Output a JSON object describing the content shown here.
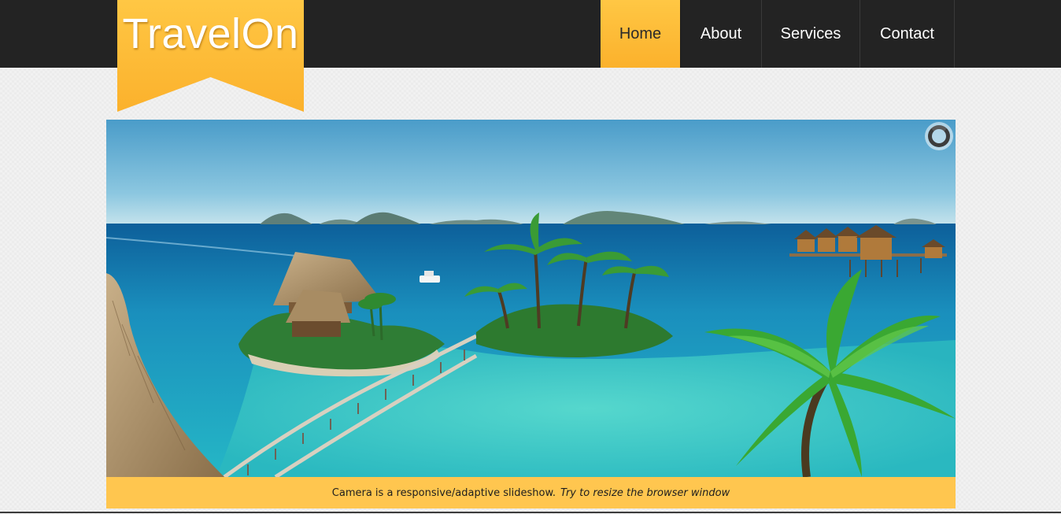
{
  "brand": {
    "logo_text": "TravelOn"
  },
  "nav": {
    "items": [
      {
        "label": "Home",
        "active": true
      },
      {
        "label": "About",
        "active": false
      },
      {
        "label": "Services",
        "active": false
      },
      {
        "label": "Contact",
        "active": false
      }
    ]
  },
  "slideshow": {
    "caption_lead": "Camera is a responsive/adaptive slideshow.",
    "caption_emphasis": "Try to resize the browser window"
  },
  "icons": {
    "loader": "loading-spinner-icon"
  },
  "colors": {
    "header_bg": "#232323",
    "accent": "#fbb12c",
    "caption_bg": "#ffc64f",
    "page_bg": "#f1f1f1"
  }
}
